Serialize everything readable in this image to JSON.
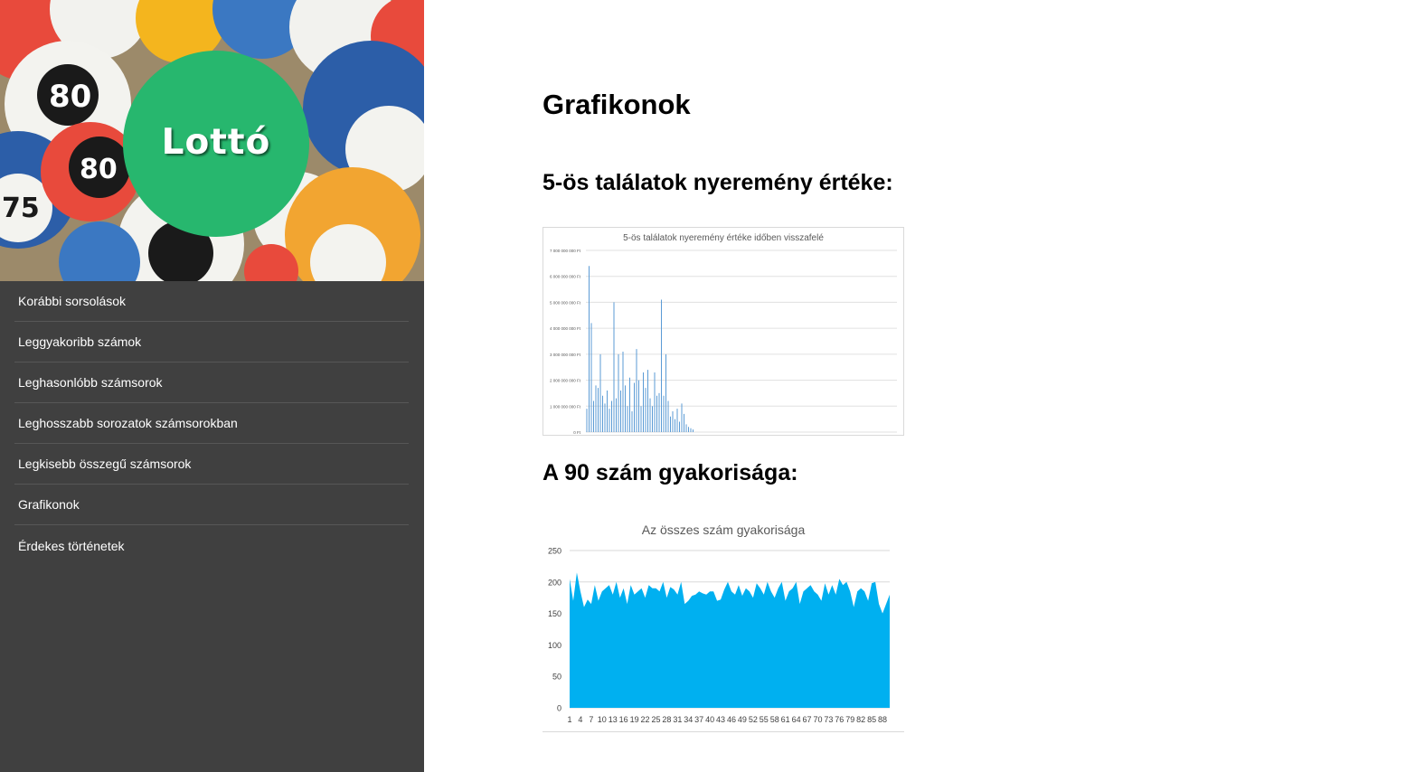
{
  "header": {
    "logo_text": "Lottó"
  },
  "sidebar": {
    "items": [
      {
        "label": "Korábbi sorsolások"
      },
      {
        "label": "Leggyakoribb számok"
      },
      {
        "label": "Leghasonlóbb számsorok"
      },
      {
        "label": "Leghosszabb sorozatok számsorokban"
      },
      {
        "label": "Legkisebb összegű számsorok"
      },
      {
        "label": "Grafikonok"
      },
      {
        "label": "Érdekes történetek"
      }
    ]
  },
  "main": {
    "title": "Grafikonok",
    "section1_title": "5-ös találatok nyeremény értéke:",
    "section2_title": "A 90 szám gyakorisága:"
  },
  "chart_data": [
    {
      "type": "bar",
      "title": "5-ös találatok nyeremény értéke időben visszafelé",
      "ylim": [
        0,
        7000000000
      ],
      "yticks": [
        "7 000 000 000 Ft",
        "6 000 000 000 Ft",
        "5 000 000 000 Ft",
        "4 000 000 000 Ft",
        "3 000 000 000 Ft",
        "2 000 000 000 Ft",
        "1 000 000 000 Ft",
        "0 Ft"
      ],
      "ytick_values": [
        7000000000,
        6000000000,
        5000000000,
        4000000000,
        3000000000,
        2000000000,
        1000000000,
        0
      ],
      "grid": true,
      "color": "#5b9bd5",
      "values": [
        900000000,
        6400000000,
        4200000000,
        1200000000,
        1800000000,
        1700000000,
        3000000000,
        1400000000,
        1100000000,
        1600000000,
        900000000,
        1200000000,
        5000000000,
        1300000000,
        3000000000,
        1600000000,
        3100000000,
        1800000000,
        1000000000,
        2100000000,
        800000000,
        1900000000,
        3200000000,
        2000000000,
        1000000000,
        2300000000,
        1700000000,
        2400000000,
        1300000000,
        1000000000,
        2300000000,
        1400000000,
        1500000000,
        5100000000,
        1400000000,
        3000000000,
        1200000000,
        600000000,
        800000000,
        500000000,
        900000000,
        400000000,
        1100000000,
        700000000,
        300000000,
        200000000,
        150000000,
        100000000
      ]
    },
    {
      "type": "area",
      "title": "Az összes szám gyakorisága",
      "ylim": [
        0,
        250
      ],
      "yticks": [
        250,
        200,
        150,
        100,
        50,
        0
      ],
      "grid": true,
      "color": "#00b0f0",
      "xtick_labels": [
        "1",
        "4",
        "7",
        "10",
        "13",
        "16",
        "19",
        "22",
        "25",
        "28",
        "31",
        "34",
        "37",
        "40",
        "43",
        "46",
        "49",
        "52",
        "55",
        "58",
        "61",
        "64",
        "67",
        "70",
        "73",
        "76",
        "79",
        "82",
        "85",
        "88"
      ],
      "x": [
        1,
        2,
        3,
        4,
        5,
        6,
        7,
        8,
        9,
        10,
        11,
        12,
        13,
        14,
        15,
        16,
        17,
        18,
        19,
        20,
        21,
        22,
        23,
        24,
        25,
        26,
        27,
        28,
        29,
        30,
        31,
        32,
        33,
        34,
        35,
        36,
        37,
        38,
        39,
        40,
        41,
        42,
        43,
        44,
        45,
        46,
        47,
        48,
        49,
        50,
        51,
        52,
        53,
        54,
        55,
        56,
        57,
        58,
        59,
        60,
        61,
        62,
        63,
        64,
        65,
        66,
        67,
        68,
        69,
        70,
        71,
        72,
        73,
        74,
        75,
        76,
        77,
        78,
        79,
        80,
        81,
        82,
        83,
        84,
        85,
        86,
        87,
        88,
        89,
        90
      ],
      "values": [
        205,
        170,
        215,
        185,
        160,
        172,
        165,
        195,
        170,
        185,
        190,
        195,
        180,
        200,
        175,
        190,
        165,
        195,
        180,
        185,
        190,
        175,
        195,
        190,
        190,
        185,
        200,
        175,
        192,
        188,
        180,
        200,
        165,
        170,
        178,
        180,
        185,
        182,
        180,
        185,
        185,
        170,
        172,
        188,
        200,
        185,
        180,
        195,
        178,
        190,
        185,
        175,
        198,
        190,
        180,
        200,
        185,
        175,
        190,
        200,
        170,
        185,
        190,
        200,
        165,
        185,
        190,
        195,
        185,
        180,
        170,
        198,
        180,
        195,
        180,
        205,
        195,
        200,
        185,
        160,
        185,
        190,
        185,
        170,
        198,
        200,
        165,
        150,
        165,
        180
      ]
    }
  ]
}
